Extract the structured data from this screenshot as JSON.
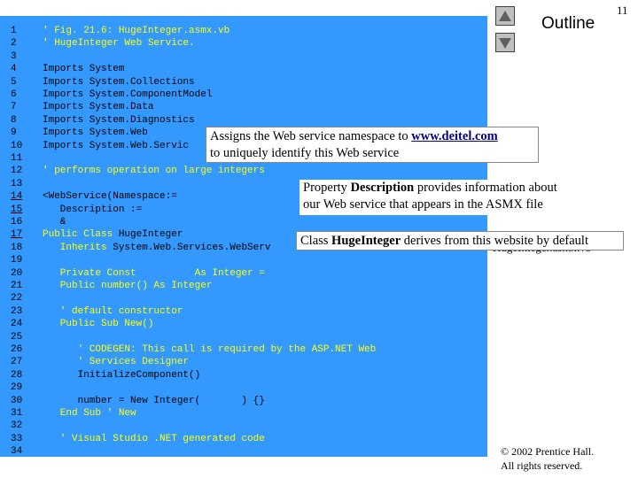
{
  "header": {
    "page_number": "11",
    "outline_label": "Outline",
    "right_text": "HugeInteger.asmx.vb"
  },
  "code_lines": [
    {
      "num": "1",
      "text": "' Fig. 21.6: HugeInteger.asmx.vb",
      "kind": "comment",
      "u": false
    },
    {
      "num": "2",
      "text": "' HugeInteger Web Service.",
      "kind": "comment",
      "u": false
    },
    {
      "num": "3",
      "text": "",
      "kind": "plain",
      "u": false
    },
    {
      "num": "4",
      "text": "Imports System",
      "kind": "plain",
      "u": false
    },
    {
      "num": "5",
      "text": "Imports System.Collections",
      "kind": "plain",
      "u": false
    },
    {
      "num": "6",
      "text": "Imports System.ComponentModel",
      "kind": "plain",
      "u": false
    },
    {
      "num": "7",
      "text": "Imports System.Data",
      "kind": "plain",
      "u": false
    },
    {
      "num": "8",
      "text": "Imports System.Diagnostics",
      "kind": "plain",
      "u": false
    },
    {
      "num": "9",
      "text": "Imports System.Web",
      "kind": "plain",
      "u": false
    },
    {
      "num": "10",
      "text": "Imports System.Web.Servic",
      "kind": "plain",
      "u": false
    },
    {
      "num": "11",
      "text": "",
      "kind": "plain",
      "u": false
    },
    {
      "num": "12",
      "text": "' performs operation on large integers",
      "kind": "comment",
      "u": false
    },
    {
      "num": "13",
      "text": "",
      "kind": "plain",
      "u": false
    },
    {
      "num": "14",
      "text": "<WebService(Namespace:=",
      "kind": "plain",
      "u": true
    },
    {
      "num": "15",
      "text": "   Description :=",
      "kind": "plain",
      "u": true
    },
    {
      "num": "16",
      "text": "   &",
      "kind": "plain",
      "u": false
    },
    {
      "num": "17",
      "text": "Public Class HugeInteger",
      "kind": "mixed",
      "kw": "Public Class",
      "rest": " HugeInteger",
      "u": true
    },
    {
      "num": "18",
      "text": "   Inherits System.Web.Services.WebServ",
      "kind": "mixed",
      "kw": "   Inherits",
      "rest": " System.Web.Services.WebServ",
      "u": false
    },
    {
      "num": "19",
      "text": "",
      "kind": "plain",
      "u": false
    },
    {
      "num": "20",
      "text": "   Private Const          As Integer =",
      "kind": "keyword",
      "u": false
    },
    {
      "num": "21",
      "text": "   Public number() As Integer",
      "kind": "keyword",
      "u": false
    },
    {
      "num": "22",
      "text": "",
      "kind": "plain",
      "u": false
    },
    {
      "num": "23",
      "text": "   ' default constructor",
      "kind": "comment",
      "u": false
    },
    {
      "num": "24",
      "text": "   Public Sub New()",
      "kind": "keyword",
      "u": false
    },
    {
      "num": "25",
      "text": "",
      "kind": "plain",
      "u": false
    },
    {
      "num": "26",
      "text": "      ' CODEGEN: This call is required by the ASP.NET Web",
      "kind": "comment",
      "u": false
    },
    {
      "num": "27",
      "text": "      ' Services Designer",
      "kind": "comment",
      "u": false
    },
    {
      "num": "28",
      "text": "      InitializeComponent()",
      "kind": "plain",
      "u": false
    },
    {
      "num": "29",
      "text": "",
      "kind": "plain",
      "u": false
    },
    {
      "num": "30",
      "text": "      number = New Integer(       ) {}",
      "kind": "mixed",
      "kw": "",
      "rest": "      number = New Integer(       ) {}",
      "u": false
    },
    {
      "num": "31",
      "text": "   End Sub ' New",
      "kind": "keyword",
      "u": false
    },
    {
      "num": "32",
      "text": "",
      "kind": "plain",
      "u": false
    },
    {
      "num": "33",
      "text": "   ' Visual Studio .NET generated code",
      "kind": "comment",
      "u": false
    },
    {
      "num": "34",
      "text": "",
      "kind": "plain",
      "u": false
    }
  ],
  "callouts": {
    "namespace": {
      "line1_pre": "Assigns the Web service namespace to ",
      "line1_link": "www.deitel.com",
      "line2": "to uniquely identify this Web service"
    },
    "description": {
      "pre": "Property ",
      "bold": "Description",
      "post": " provides information about",
      "line2": "our Web service that appears in the ASMX file"
    },
    "inherits": {
      "pre": "Class ",
      "bold": "HugeInteger",
      "post": " derives from this website by default"
    }
  },
  "footer": {
    "copyright_line1": "© 2002 Prentice Hall.",
    "copyright_line2": "All rights reserved."
  },
  "icons": {
    "prev": "triangle-up-icon",
    "next": "triangle-down-icon"
  }
}
